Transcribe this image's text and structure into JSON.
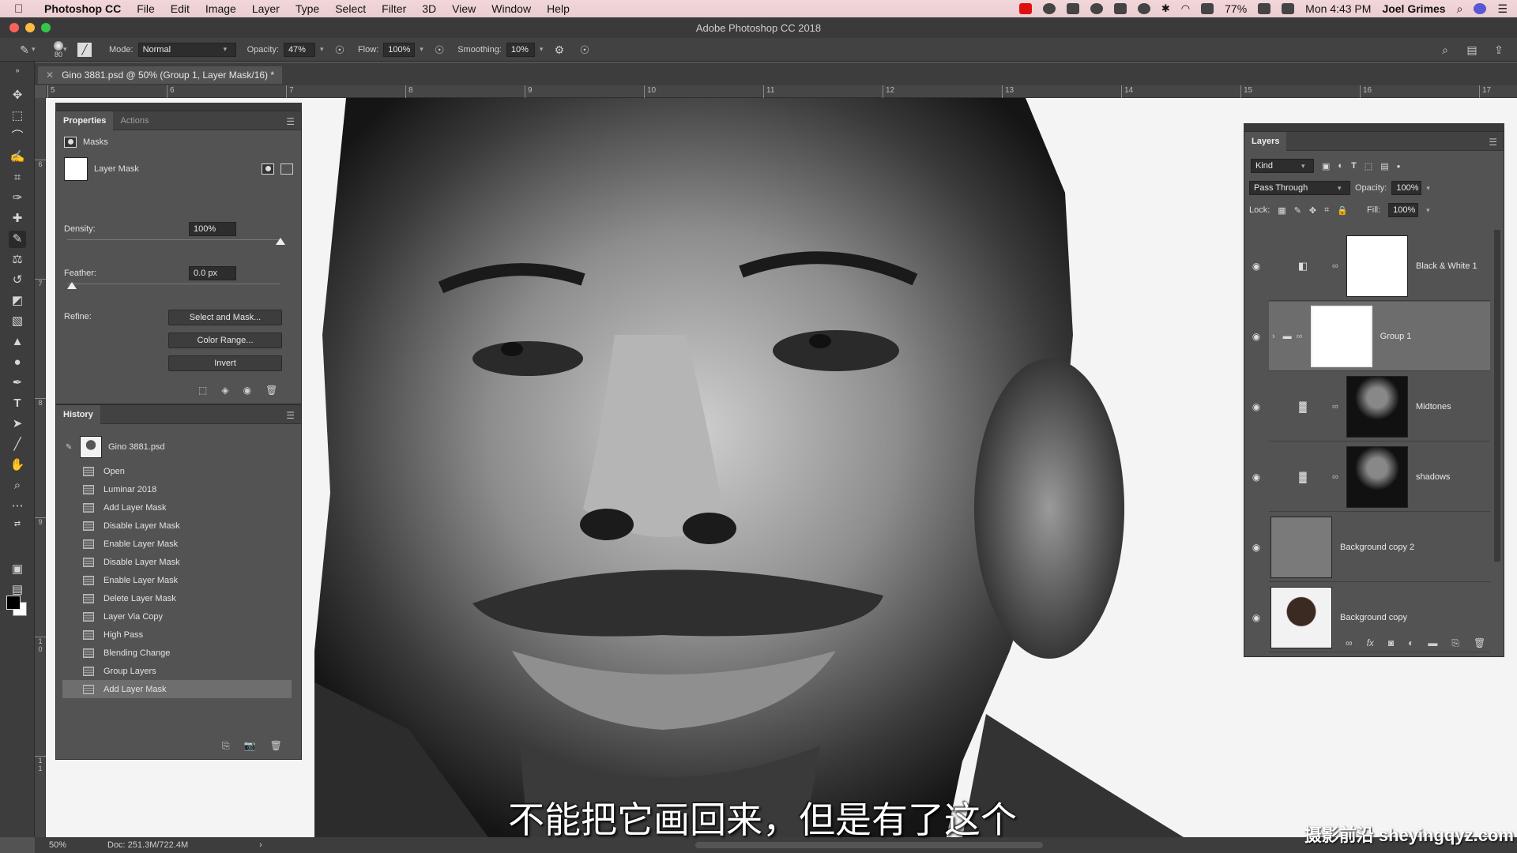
{
  "menubar": {
    "app_name": "Photoshop CC",
    "items": [
      "File",
      "Edit",
      "Image",
      "Layer",
      "Type",
      "Select",
      "Filter",
      "3D",
      "View",
      "Window",
      "Help"
    ],
    "battery": "77%",
    "clock": "Mon 4:43 PM",
    "user": "Joel Grimes"
  },
  "window": {
    "title": "Adobe Photoshop CC 2018"
  },
  "options": {
    "brush_size": "80",
    "mode_label": "Mode:",
    "mode_value": "Normal",
    "opacity_label": "Opacity:",
    "opacity_value": "47%",
    "flow_label": "Flow:",
    "flow_value": "100%",
    "smoothing_label": "Smoothing:",
    "smoothing_value": "10%"
  },
  "document": {
    "tab_label": "Gino 3881.psd @ 50% (Group 1, Layer Mask/16) *",
    "zoom": "50%",
    "doc_size": "Doc: 251.3M/722.4M",
    "ruler_h": [
      "5",
      "6",
      "7",
      "8",
      "9",
      "10",
      "11",
      "12",
      "13",
      "14",
      "15",
      "16",
      "17"
    ],
    "ruler_v": [
      "6",
      "7",
      "8",
      "9",
      "1\n0",
      "1\n1"
    ]
  },
  "properties": {
    "tabs": [
      "Properties",
      "Actions"
    ],
    "section": "Masks",
    "mask_label": "Layer Mask",
    "density_label": "Density:",
    "density_value": "100%",
    "density": 1.0,
    "feather_label": "Feather:",
    "feather_value": "0.0 px",
    "feather": 0.0,
    "refine_label": "Refine:",
    "buttons": [
      "Select and Mask...",
      "Color Range...",
      "Invert"
    ]
  },
  "history": {
    "title": "History",
    "snapshot": "Gino 3881.psd",
    "items": [
      "Open",
      "Luminar 2018",
      "Add Layer Mask",
      "Disable Layer Mask",
      "Enable Layer Mask",
      "Disable Layer Mask",
      "Enable Layer Mask",
      "Delete Layer Mask",
      "Layer Via Copy",
      "High Pass",
      "Blending Change",
      "Group Layers",
      "Add Layer Mask"
    ],
    "selected_index": 12
  },
  "layers": {
    "title": "Layers",
    "filter_kind": "Kind",
    "blend_mode": "Pass Through",
    "opacity_label": "Opacity:",
    "opacity_value": "100%",
    "lock_label": "Lock:",
    "fill_label": "Fill:",
    "fill_value": "100%",
    "rows": [
      {
        "name": "Black & White 1",
        "type": "adjustment-bw",
        "selected": false
      },
      {
        "name": "Group 1",
        "type": "group",
        "selected": true
      },
      {
        "name": "Midtones",
        "type": "adjustment-levels",
        "selected": false
      },
      {
        "name": "shadows",
        "type": "adjustment-levels",
        "selected": false
      },
      {
        "name": "Background copy 2",
        "type": "pixel-gray",
        "selected": false
      },
      {
        "name": "Background copy",
        "type": "pixel-photo",
        "selected": false
      }
    ]
  },
  "overlay": {
    "subtitle": "不能把它画回来，但是有了这个",
    "watermark": "摄影前沿 sheyingqyz.com"
  },
  "colors": {
    "accent": "#6e6e6e",
    "panel": "#535353",
    "dark": "#3d3d3d"
  }
}
